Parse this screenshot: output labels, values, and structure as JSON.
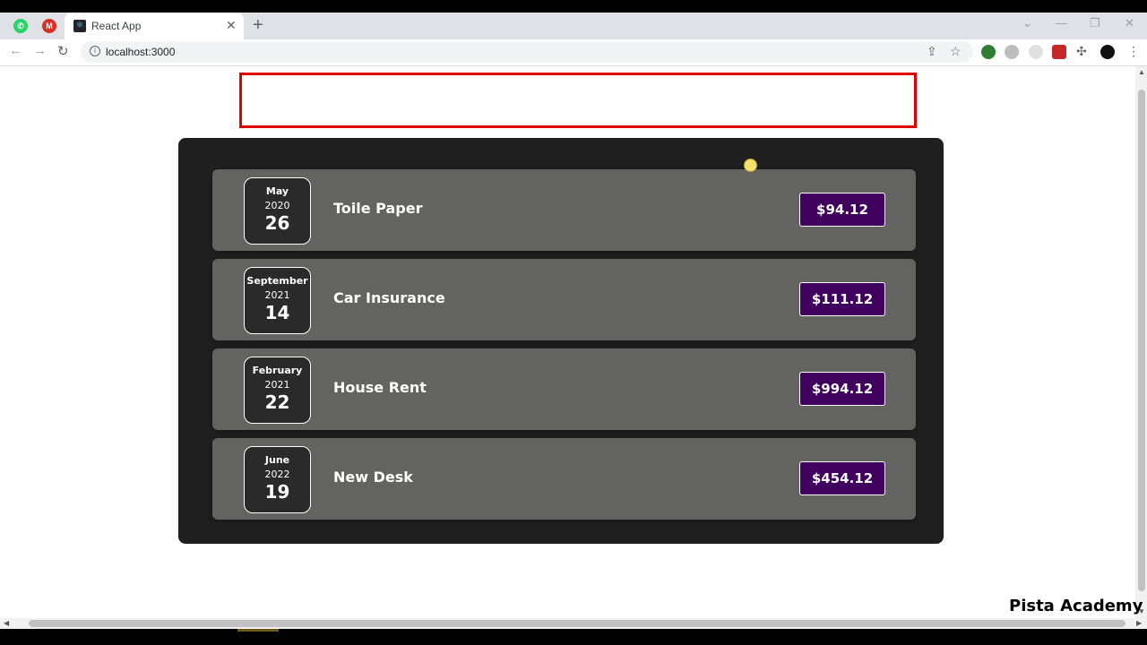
{
  "browser": {
    "tab_title": "React App",
    "url": "localhost:3000"
  },
  "expenses": [
    {
      "month": "May",
      "year": "2020",
      "day": "26",
      "title": "Toile Paper",
      "amount": "$94.12"
    },
    {
      "month": "September",
      "year": "2021",
      "day": "14",
      "title": "Car Insurance",
      "amount": "$111.12"
    },
    {
      "month": "February",
      "year": "2021",
      "day": "22",
      "title": "House Rent",
      "amount": "$994.12"
    },
    {
      "month": "June",
      "year": "2022",
      "day": "19",
      "title": "New Desk",
      "amount": "$454.12"
    }
  ],
  "watermark": "Pista Academy",
  "colors": {
    "container_bg": "#1f1f1f",
    "item_bg": "#636361",
    "price_bg": "#40005d",
    "highlight_border": "#e00000"
  }
}
